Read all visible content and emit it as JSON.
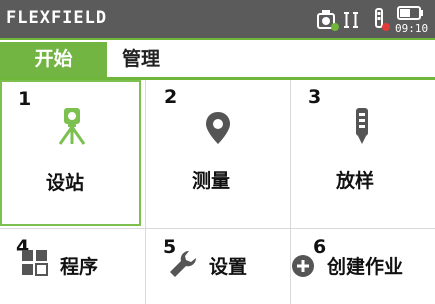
{
  "app": {
    "title": "FLEXFIELD",
    "time": "09:10"
  },
  "tabs": [
    {
      "label": "开始",
      "active": true
    },
    {
      "label": "管理",
      "active": false
    }
  ],
  "tiles": [
    {
      "number": "1",
      "label": "设站",
      "icon": "station-tripod-icon",
      "selected": true
    },
    {
      "number": "2",
      "label": "测量",
      "icon": "location-pin-icon",
      "selected": false
    },
    {
      "number": "3",
      "label": "放样",
      "icon": "prism-pole-icon",
      "selected": false
    },
    {
      "number": "4",
      "label": "程序",
      "icon": "apps-grid-icon",
      "selected": false
    },
    {
      "number": "5",
      "label": "设置",
      "icon": "wrench-icon",
      "selected": false
    },
    {
      "number": "6",
      "label": "创建作业",
      "icon": "add-circle-icon",
      "selected": false
    }
  ],
  "colors": {
    "accent": "#72b542",
    "titlebar": "#5b5b5b",
    "icon_green": "#7cc050",
    "icon_gray": "#555555"
  }
}
